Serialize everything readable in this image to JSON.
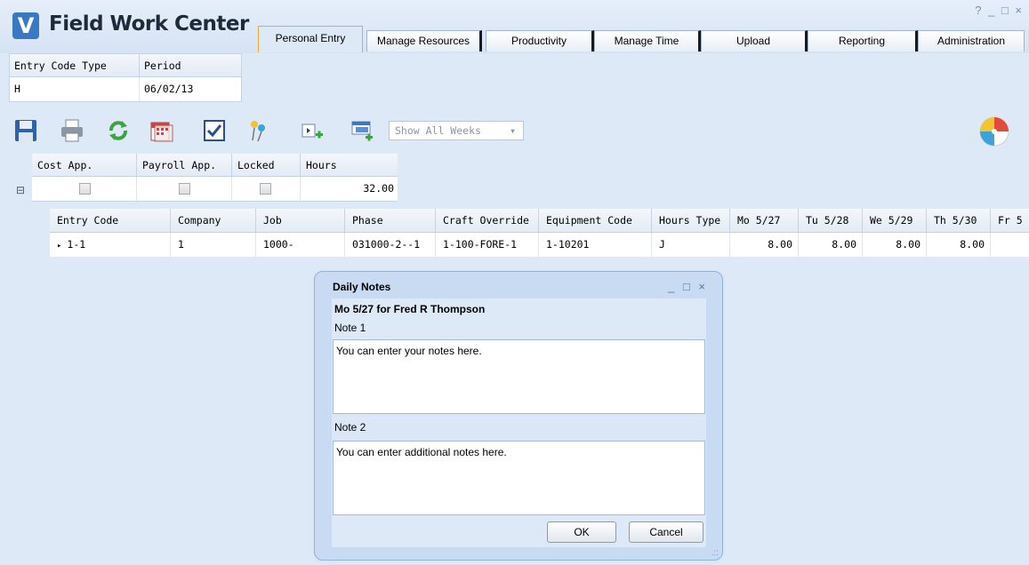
{
  "app": {
    "title": "Field Work Center",
    "logo_letter": "V",
    "window_controls": "? _ □ ×"
  },
  "tabs": [
    {
      "label": "Personal Entry",
      "active": true
    },
    {
      "label": "Manage Resources",
      "active": false
    },
    {
      "label": "Productivity",
      "active": false
    },
    {
      "label": "Manage Time",
      "active": false
    },
    {
      "label": "Upload",
      "active": false
    },
    {
      "label": "Reporting",
      "active": false
    },
    {
      "label": "Administration",
      "active": false
    }
  ],
  "entry": {
    "headers": [
      "Entry Code Type",
      "Period"
    ],
    "values": [
      "H",
      "06/02/13"
    ]
  },
  "toolbar": {
    "icons": [
      "save-icon",
      "print-icon",
      "refresh-icon",
      "calendar-icon",
      "checkbox-icon",
      "pin-icon",
      "add-column-icon",
      "add-row-icon"
    ],
    "week_select": "Show All Weeks",
    "week_caret": "▾",
    "logo_icon": "beach-ball-icon"
  },
  "summary": {
    "headers": [
      "Cost App.",
      "Payroll App.",
      "Locked",
      "Hours"
    ],
    "checked": [
      false,
      false,
      false
    ],
    "hours": "32.00",
    "expand_symbol": "⊟"
  },
  "detail": {
    "headers": [
      "Entry Code",
      "Company",
      "Job",
      "Phase",
      "Craft Override",
      "Equipment Code",
      "Hours Type",
      "Mo 5/27",
      "Tu 5/28",
      "We 5/29",
      "Th 5/30",
      "Fr 5"
    ],
    "row": [
      "1-1",
      "1",
      "1000-",
      "031000-2--1",
      "1-100-FORE-1",
      "1-10201",
      "J",
      "8.00",
      "8.00",
      "8.00",
      "8.00",
      ""
    ],
    "row_marker": "▸"
  },
  "dialog": {
    "title": "Daily Notes",
    "controls": "_ □ ×",
    "subtitle": "Mo 5/27 for Fred R Thompson",
    "note1_label": "Note 1",
    "note1_text": "You can enter your notes here.",
    "note2_label": "Note 2",
    "note2_text": "You can enter additional notes here.",
    "ok_label": "OK",
    "cancel_label": "Cancel",
    "grip": ".::"
  },
  "colors": {
    "accent": "#3a78c4",
    "active_tab_border": "#f0a830",
    "background": "#dde9f7"
  }
}
